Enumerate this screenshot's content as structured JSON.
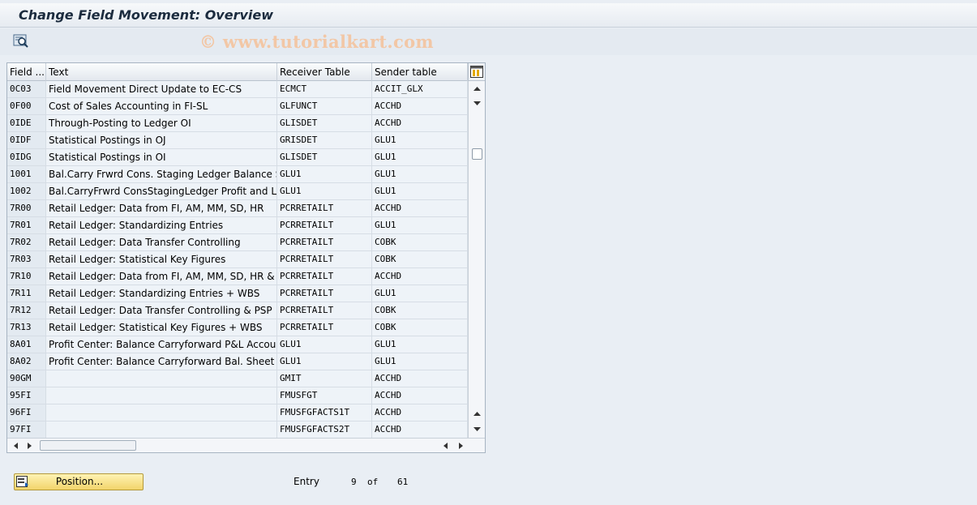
{
  "window": {
    "title": "Change Field Movement: Overview"
  },
  "watermark": "© www.tutorialkart.com",
  "toolbar": {
    "icon": "search-detail-icon"
  },
  "table": {
    "columns": [
      "Field ...",
      "Text",
      "Receiver Table",
      "Sender table"
    ],
    "rows": [
      [
        "0C03",
        "Field Movement Direct Update to EC-CS",
        "ECMCT",
        "ACCIT_GLX"
      ],
      [
        "0F00",
        "Cost of Sales Accounting in FI-SL",
        "GLFUNCT",
        "ACCHD"
      ],
      [
        "0IDE",
        "Through-Posting to Ledger OI",
        "GLISDET",
        "ACCHD"
      ],
      [
        "0IDF",
        "Statistical Postings in OJ",
        "GRISDET",
        "GLU1"
      ],
      [
        "0IDG",
        "Statistical Postings in OI",
        "GLISDET",
        "GLU1"
      ],
      [
        "1001",
        "Bal.Carry Frwrd Cons. Staging Ledger Balance Sheet",
        "GLU1",
        "GLU1"
      ],
      [
        "1002",
        "Bal.CarryFrwrd ConsStagingLedger Profit and Loss",
        "GLU1",
        "GLU1"
      ],
      [
        "7R00",
        "Retail Ledger: Data from FI, AM, MM, SD, HR",
        "PCRRETAILT",
        "ACCHD"
      ],
      [
        "7R01",
        "Retail Ledger: Standardizing Entries",
        "PCRRETAILT",
        "GLU1"
      ],
      [
        "7R02",
        "Retail Ledger: Data Transfer Controlling",
        "PCRRETAILT",
        "COBK"
      ],
      [
        "7R03",
        "Retail Ledger: Statistical Key Figures",
        "PCRRETAILT",
        "COBK"
      ],
      [
        "7R10",
        "Retail Ledger: Data from FI, AM, MM, SD, HR & PSP",
        "PCRRETAILT",
        "ACCHD"
      ],
      [
        "7R11",
        "Retail Ledger: Standardizing Entries + WBS",
        "PCRRETAILT",
        "GLU1"
      ],
      [
        "7R12",
        "Retail Ledger: Data Transfer Controlling & PSP",
        "PCRRETAILT",
        "COBK"
      ],
      [
        "7R13",
        "Retail Ledger: Statistical Key Figures + WBS",
        "PCRRETAILT",
        "COBK"
      ],
      [
        "8A01",
        "Profit Center: Balance Carryforward P&L Accounts",
        "GLU1",
        "GLU1"
      ],
      [
        "8A02",
        "Profit Center: Balance Carryforward Bal. Sheet",
        "GLU1",
        "GLU1"
      ],
      [
        "90GM",
        "",
        "GMIT",
        "ACCHD"
      ],
      [
        "95FI",
        "",
        "FMUSFGT",
        "ACCHD"
      ],
      [
        "96FI",
        "",
        "FMUSFGFACTS1T",
        "ACCHD"
      ],
      [
        "97FI",
        "",
        "FMUSFGFACTS2T",
        "ACCHD"
      ]
    ]
  },
  "footer": {
    "position_button": "Position...",
    "entry_label": "Entry",
    "entry_current": "9",
    "of_label": "of",
    "entry_total": "61"
  },
  "colors": {
    "button": "#f2d46b",
    "header": "#e3e8ee",
    "key_column": "#e3eaf1"
  }
}
